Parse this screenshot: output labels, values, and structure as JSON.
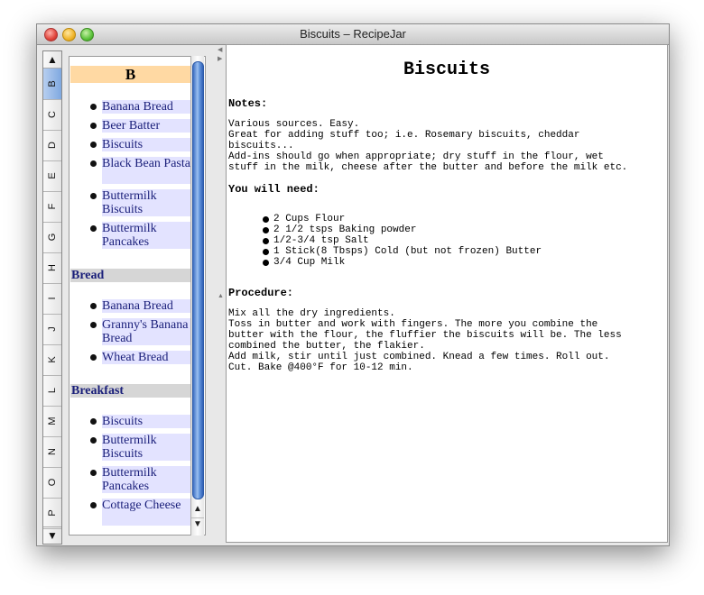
{
  "window": {
    "title": "Biscuits – RecipeJar"
  },
  "letters": [
    "B",
    "C",
    "D",
    "E",
    "F",
    "G",
    "H",
    "I",
    "J",
    "K",
    "L",
    "M",
    "N",
    "O",
    "P"
  ],
  "active_letter": "B",
  "index": {
    "letter_header": "B",
    "b_items": [
      "Banana Bread",
      "Beer Batter",
      "Biscuits",
      "Black Bean Pasta",
      "Buttermilk Biscuits",
      "Buttermilk Pancakes"
    ],
    "sections": [
      {
        "name": "Bread",
        "items": [
          "Banana Bread",
          "Granny's Banana Bread",
          "Wheat Bread"
        ]
      },
      {
        "name": "Breakfast",
        "items": [
          "Biscuits",
          "Buttermilk Biscuits",
          "Buttermilk Pancakes",
          "Cottage Cheese"
        ]
      }
    ]
  },
  "recipe": {
    "title": "Biscuits",
    "notes_label": "Notes:",
    "notes": [
      "Various sources. Easy.",
      "Great for adding stuff too; i.e. Rosemary biscuits, cheddar",
      "biscuits...",
      "Add-ins should go when appropriate; dry stuff in the flour, wet",
      "stuff in the milk, cheese after the butter and before the milk etc."
    ],
    "need_label": "You will need:",
    "ingredients": [
      "2 Cups Flour",
      "2 1/2 tsps Baking powder",
      "1/2-3/4 tsp Salt",
      "1 Stick(8 Tbsps) Cold (but not frozen) Butter",
      "3/4 Cup Milk"
    ],
    "procedure_label": "Procedure:",
    "procedure": [
      "Mix all the dry ingredients.",
      "Toss in butter and work with fingers. The more you combine the",
      "butter with the flour, the fluffier the biscuits will be. The less",
      "combined the butter, the flakier.",
      "Add milk, stir until just combined. Knead a few times. Roll out.",
      "Cut. Bake @400°F for 10-12 min."
    ]
  },
  "icons": {
    "close": "close-icon",
    "minimize": "minimize-icon",
    "zoom": "zoom-icon",
    "up": "arrow-up-icon",
    "down": "arrow-down-icon",
    "bullet": "bullet-icon"
  },
  "colors": {
    "header_b": "#ffd9a3",
    "item_bg": "#e3e3ff",
    "link_text": "#1a1f7a",
    "section_bg": "#d6d6d6"
  }
}
